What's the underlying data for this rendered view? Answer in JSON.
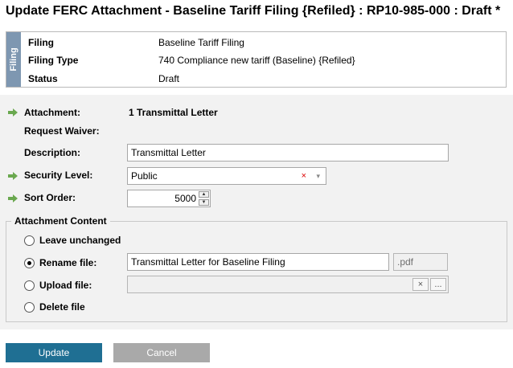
{
  "page": {
    "title": "Update FERC Attachment - Baseline Tariff Filing {Refiled} : RP10-985-000 : Draft *"
  },
  "info": {
    "tab_label": "Filing",
    "rows": [
      {
        "label": "Filing",
        "value": "Baseline Tariff Filing"
      },
      {
        "label": "Filing Type",
        "value": "740 Compliance new tariff (Baseline) {Refiled}"
      },
      {
        "label": "Status",
        "value": "Draft"
      }
    ]
  },
  "form": {
    "attachment": {
      "label": "Attachment:",
      "value": "1 Transmittal Letter"
    },
    "request_waiver": {
      "label": "Request Waiver:"
    },
    "description": {
      "label": "Description:",
      "value": "Transmittal Letter"
    },
    "security_level": {
      "label": "Security Level:",
      "value": "Public",
      "clear_glyph": "×",
      "dropdown_glyph": "▾"
    },
    "sort_order": {
      "label": "Sort Order:",
      "value": "5000"
    },
    "attachment_content": {
      "legend": "Attachment Content",
      "options": [
        {
          "label": "Leave unchanged",
          "selected": false
        },
        {
          "label": "Rename file:",
          "selected": true
        },
        {
          "label": "Upload file:",
          "selected": false
        },
        {
          "label": "Delete file",
          "selected": false
        }
      ],
      "rename_value": "Transmittal Letter for Baseline Filing",
      "extension": ".pdf",
      "upload_clear_glyph": "×",
      "upload_browse_glyph": "..."
    }
  },
  "buttons": {
    "update": "Update",
    "cancel": "Cancel"
  },
  "colors": {
    "accent": "#1f6f93",
    "tab": "#7e97b1",
    "required_arrow": "#6aa84f"
  }
}
